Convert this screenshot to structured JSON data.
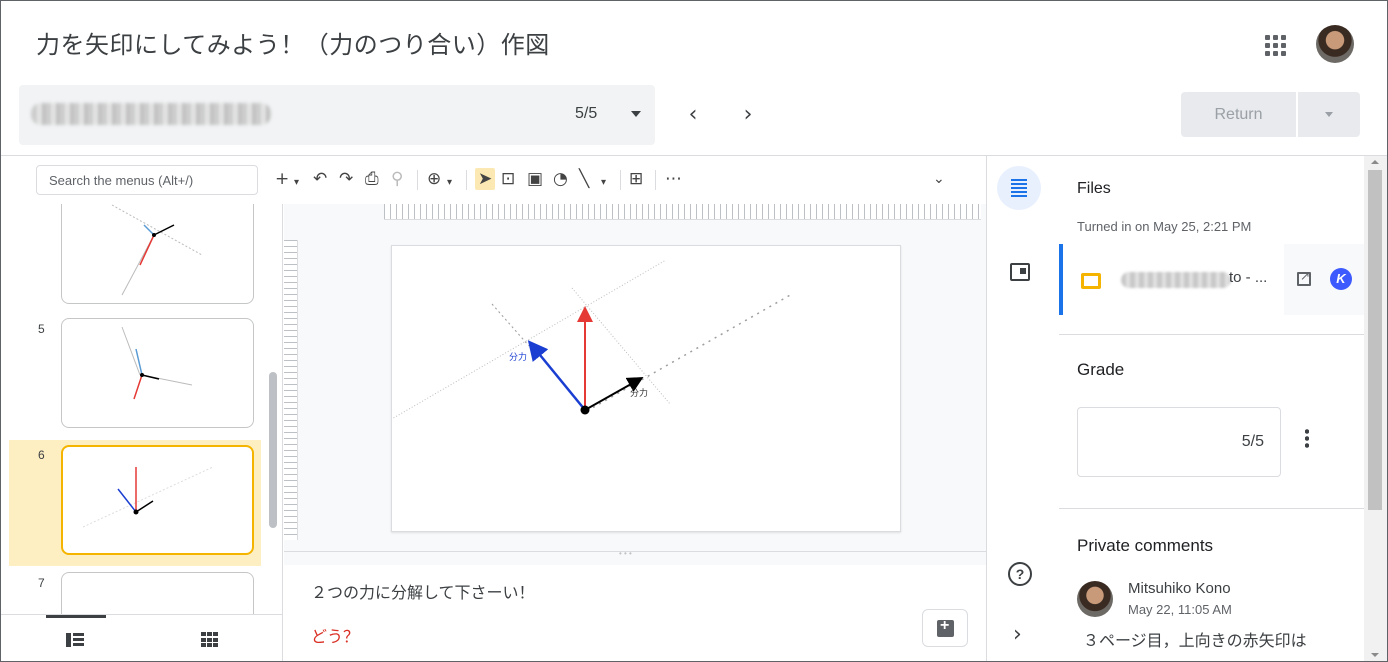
{
  "header": {
    "title": "力を矢印にしてみよう！（力のつり合い）作図",
    "student_count": "5/5",
    "return_label": "Return"
  },
  "toolbar": {
    "search_placeholder": "Search the menus (Alt+/)",
    "tools": [
      "plus-icon",
      "undo-icon",
      "redo-icon",
      "print-icon",
      "paint-format-icon",
      "zoom-icon",
      "select-icon",
      "textbox-icon",
      "image-icon",
      "shape-icon",
      "line-icon",
      "comment-icon",
      "more-icon"
    ]
  },
  "filmstrip": {
    "slides": [
      {
        "num": "",
        "selected": false
      },
      {
        "num": "5",
        "selected": false
      },
      {
        "num": "6",
        "selected": true
      },
      {
        "num": "7",
        "selected": false
      }
    ]
  },
  "slide": {
    "label_left": "分力",
    "label_right": "分力",
    "colors": {
      "red": "#e53935",
      "blue": "#1a3ed1",
      "black": "#000000",
      "guide": "#9e9e9e"
    }
  },
  "notes": {
    "line1": "２つの力に分解して下さーい！",
    "line2": "どう？"
  },
  "panel": {
    "files_title": "Files",
    "turned_in": "Turned in on May 25, 2:21 PM",
    "file_name_suffix": "to - ...",
    "grade_title": "Grade",
    "grade_value": "5/5",
    "private_comments_title": "Private comments",
    "commenter": "Mitsuhiko Kono",
    "comment_time": "May 22, 11:05 AM",
    "comment_text": "３ページ目，上向きの赤矢印は"
  },
  "colors": {
    "accent": "#1a73e8",
    "selected": "#f4b400",
    "selected_bg": "#feefc3"
  }
}
